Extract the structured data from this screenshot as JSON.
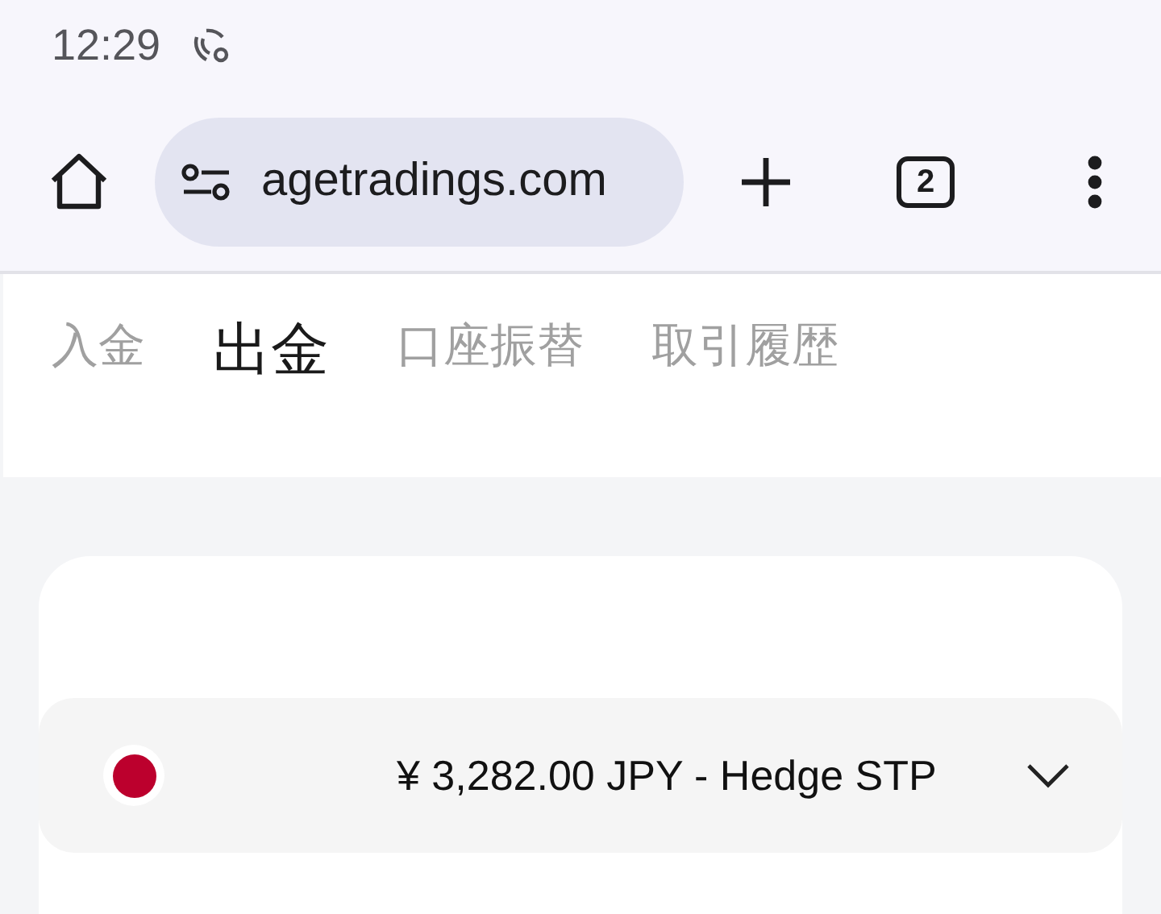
{
  "status_bar": {
    "time": "12:29"
  },
  "browser": {
    "url": "agetradings.com",
    "tab_count": "2"
  },
  "tabs": [
    {
      "label": "入金",
      "selected": false
    },
    {
      "label": "出金",
      "selected": true
    },
    {
      "label": "口座振替",
      "selected": false
    },
    {
      "label": "取引履歴",
      "selected": false
    }
  ],
  "account_select": {
    "value": "¥ 3,282.00 JPY - Hedge STP"
  }
}
